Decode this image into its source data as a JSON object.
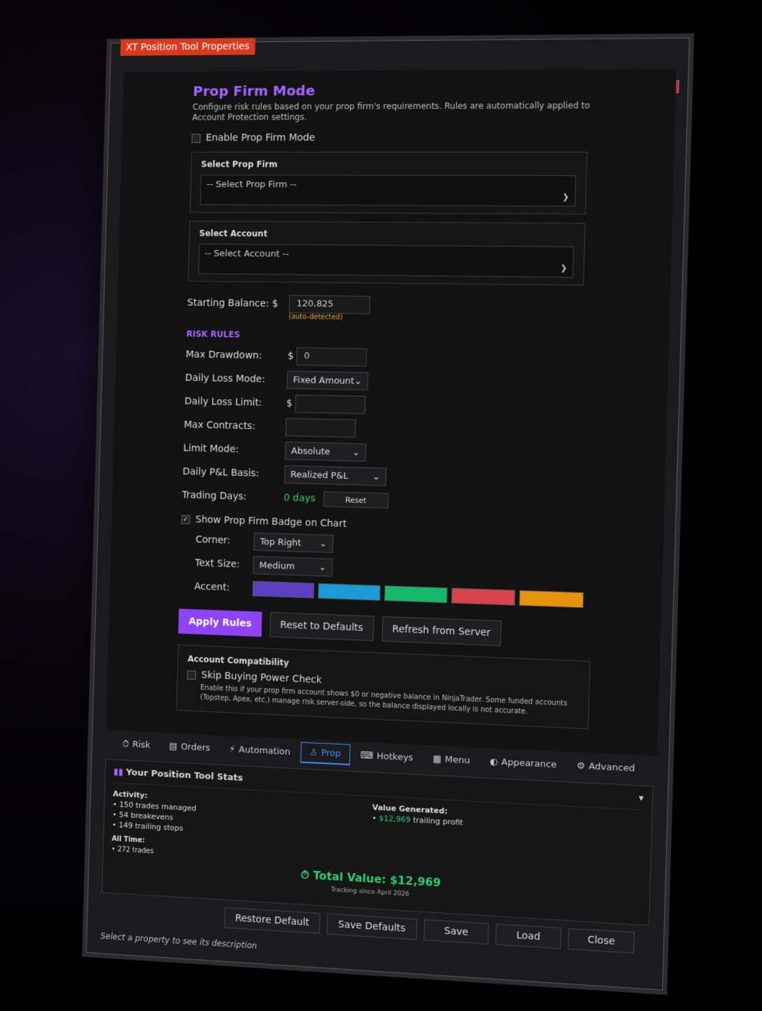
{
  "window": {
    "title": "XT Position Tool Properties",
    "controls": [
      "—",
      "□",
      "✕"
    ]
  },
  "prop": {
    "heading": "Prop Firm Mode",
    "description": "Configure risk rules based on your prop firm's requirements. Rules are automatically applied to Account Protection settings.",
    "enable_label": "Enable Prop Firm Mode",
    "select_firm_label": "Select Prop Firm",
    "select_firm_value": "-- Select Prop Firm --",
    "select_account_label": "Select Account",
    "select_account_value": "-- Select Account --",
    "starting_balance_label": "Starting Balance: $",
    "starting_balance_value": "120,825",
    "auto_detected": "(auto-detected)"
  },
  "risk": {
    "section": "RISK RULES",
    "max_drawdown_label": "Max Drawdown:",
    "max_drawdown_prefix": "$",
    "max_drawdown_value": "0",
    "daily_loss_mode_label": "Daily Loss Mode:",
    "daily_loss_mode_value": "Fixed Amount",
    "daily_loss_limit_label": "Daily Loss Limit:",
    "daily_loss_limit_prefix": "$",
    "max_contracts_label": "Max Contracts:",
    "limit_mode_label": "Limit Mode:",
    "limit_mode_value": "Absolute",
    "pnl_basis_label": "Daily P&L Basis:",
    "pnl_basis_value": "Realized P&L",
    "trading_days_label": "Trading Days:",
    "trading_days_value": "0 days",
    "reset_label": "Reset"
  },
  "badge": {
    "show_label": "Show Prop Firm Badge on Chart",
    "corner_label": "Corner:",
    "corner_value": "Top Right",
    "text_size_label": "Text Size:",
    "text_size_value": "Medium",
    "accent_label": "Accent:",
    "accent_colors": [
      "#5b3fc4",
      "#1a9ad6",
      "#16b86a",
      "#d9434b",
      "#e8930c"
    ]
  },
  "actions": {
    "apply": "Apply Rules",
    "reset_defaults": "Reset to Defaults",
    "refresh": "Refresh from Server"
  },
  "compat": {
    "title": "Account Compatibility",
    "skip_label": "Skip Buying Power Check",
    "skip_desc": "Enable this if your prop firm account shows $0 or negative balance in NinjaTrader. Some funded accounts (Topstep, Apex, etc.) manage risk server-side, so the balance displayed locally is not accurate."
  },
  "tabs": [
    {
      "label": "Risk",
      "icon": "timer-icon",
      "glyph": "⏱"
    },
    {
      "label": "Orders",
      "icon": "orders-icon",
      "glyph": "▤"
    },
    {
      "label": "Automation",
      "icon": "bolt-icon",
      "glyph": "⚡"
    },
    {
      "label": "Prop",
      "icon": "person-icon",
      "glyph": "♙"
    },
    {
      "label": "Hotkeys",
      "icon": "keyboard-icon",
      "glyph": "⌨"
    },
    {
      "label": "Menu",
      "icon": "menu-icon",
      "glyph": "▦"
    },
    {
      "label": "Appearance",
      "icon": "palette-icon",
      "glyph": "◐"
    },
    {
      "label": "Advanced",
      "icon": "gear-icon",
      "glyph": "⚙"
    }
  ],
  "active_tab": "Prop",
  "stats": {
    "title": "Your Position Tool Stats",
    "activity_label": "Activity:",
    "activity": [
      "• 150 trades managed",
      "• 54 breakevens",
      "• 149 trailing stops"
    ],
    "alltime_label": "All Time:",
    "alltime": [
      "• 272 trades"
    ],
    "value_label": "Value Generated:",
    "value_bullet": "•",
    "value_amount": "$12,969",
    "value_text": "trailing profit",
    "total": "Total Value: $12,969",
    "since": "Tracking since April 2026"
  },
  "footer_buttons": {
    "restore": "Restore Default",
    "save_defaults": "Save Defaults",
    "save": "Save",
    "load": "Load",
    "close": "Close"
  },
  "status": "Select a property to see its description"
}
